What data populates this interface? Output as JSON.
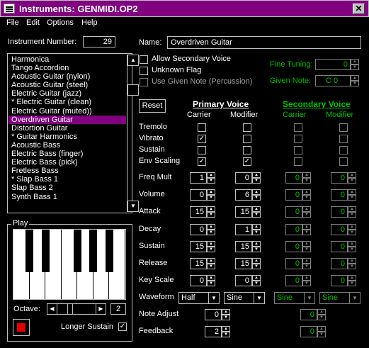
{
  "window": {
    "title": "Instruments: GENMIDI.OP2"
  },
  "menu": [
    "File",
    "Edit",
    "Options",
    "Help"
  ],
  "instrument_number": {
    "label": "Instrument Number:",
    "value": "29"
  },
  "name": {
    "label": "Name:",
    "value": "Overdriven Guitar"
  },
  "instruments": [
    "Harmonica",
    "Tango Accordion",
    "Acoustic Guitar (nylon)",
    "Acoustic Guitar (steel)",
    "Electric Guitar (jazz)",
    "* Electric Guitar (clean)",
    "Electric Guitar (muted))",
    "Overdriven Guitar",
    "Distortion Guitar",
    "* Guitar Harmonics",
    "Acoustic Bass",
    "Electric Bass (finger)",
    "Electric Bass (pick)",
    "Fretless Bass",
    "* Slap Bass 1",
    "Slap Bass 2",
    "Synth Bass 1"
  ],
  "selected_instrument": "Overdriven Guitar",
  "flags": {
    "allow_secondary": {
      "label": "Allow Secondary Voice",
      "checked": false
    },
    "unknown": {
      "label": "Unknown Flag",
      "checked": false
    },
    "use_given_note": {
      "label": "Use Given Note (Percussion)",
      "checked": false
    }
  },
  "fine_tuning": {
    "label": "Fine Tuning:",
    "value": "0"
  },
  "given_note": {
    "label": "Given Note:",
    "value": "C 0"
  },
  "reset_label": "Reset",
  "voices": {
    "primary": {
      "title": "Primary Voice",
      "carrier": "Carrier",
      "modifier": "Modifier"
    },
    "secondary": {
      "title": "Secondary Voice",
      "carrier": "Carrier",
      "modifier": "Modifier"
    }
  },
  "rows": {
    "tremolo": "Tremolo",
    "vibrato": "Vibrato",
    "sustain_flag": "Sustain",
    "env_scaling": "Env Scaling",
    "freq_mult": "Freq Mult",
    "volume": "Volume",
    "attack": "Attack",
    "decay": "Decay",
    "sustain": "Sustain",
    "release": "Release",
    "key_scale": "Key Scale",
    "waveform": "Waveform",
    "note_adjust": "Note Adjust",
    "feedback": "Feedback"
  },
  "primary_checks": {
    "carrier": {
      "tremolo": false,
      "vibrato": true,
      "sustain": false,
      "env_scaling": true
    },
    "modifier": {
      "tremolo": false,
      "vibrato": false,
      "sustain": false,
      "env_scaling": true
    }
  },
  "primary_values": {
    "carrier": {
      "freq_mult": "1",
      "volume": "0",
      "attack": "15",
      "decay": "0",
      "sustain": "15",
      "release": "15",
      "key_scale": "0"
    },
    "modifier": {
      "freq_mult": "0",
      "volume": "6",
      "attack": "15",
      "decay": "1",
      "sustain": "15",
      "release": "15",
      "key_scale": "0"
    }
  },
  "secondary_values": {
    "carrier": {
      "freq_mult": "0",
      "volume": "0",
      "attack": "0",
      "decay": "0",
      "sustain": "0",
      "release": "0",
      "key_scale": "0"
    },
    "modifier": {
      "freq_mult": "0",
      "volume": "0",
      "attack": "0",
      "decay": "0",
      "sustain": "0",
      "release": "0",
      "key_scale": "0"
    }
  },
  "waveforms": {
    "p_carrier": "Half",
    "p_modifier": "Sine",
    "s_carrier": "Sine",
    "s_modifier": "Sine"
  },
  "note_adjust": {
    "primary": "0",
    "secondary": "0"
  },
  "feedback": {
    "primary": "2",
    "secondary": "0"
  },
  "play": {
    "label": "Play",
    "octave_label": "Octave:",
    "octave_value": "2",
    "longer_sustain": "Longer Sustain",
    "longer_sustain_checked": true
  },
  "colors": {
    "titlebar": "#800080",
    "selection": "#800080",
    "secondary_text": "#00c000",
    "stop_button": "#e00000"
  }
}
